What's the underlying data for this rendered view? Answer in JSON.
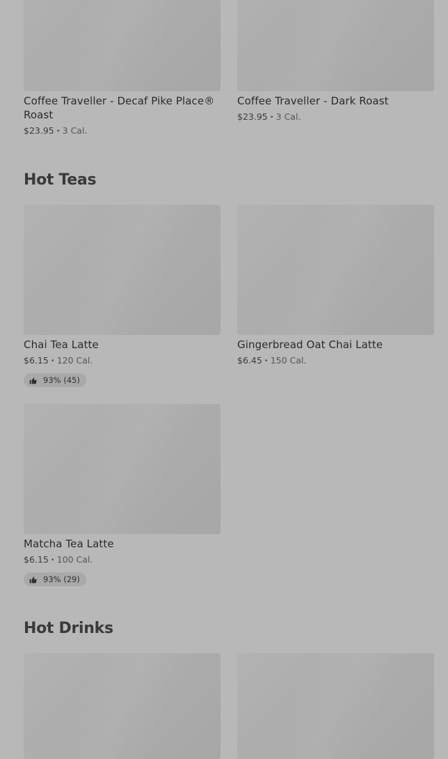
{
  "sections": [
    {
      "items": [
        {
          "name": "Coffee Traveller - Decaf Pike Place® Roast",
          "price": "$23.95",
          "calories": "3 Cal."
        },
        {
          "name": "Coffee Traveller - Dark Roast",
          "price": "$23.95",
          "calories": "3 Cal."
        }
      ]
    },
    {
      "title": "Hot Teas",
      "items": [
        {
          "name": "Chai Tea Latte",
          "price": "$6.15",
          "calories": "120 Cal.",
          "rating": "93% (45)"
        },
        {
          "name": "Gingerbread Oat Chai Latte",
          "price": "$6.45",
          "calories": "150 Cal."
        },
        {
          "name": "Matcha Tea Latte",
          "price": "$6.15",
          "calories": "100 Cal.",
          "rating": "93% (29)"
        }
      ]
    },
    {
      "title": "Hot Drinks"
    }
  ],
  "separator": "•",
  "icons": {
    "rating": "thumbs-up-icon"
  },
  "colors": {
    "background": "#b8b8b8",
    "image_placeholder": "#acacac",
    "rating_pill": "#a9a9a9"
  }
}
